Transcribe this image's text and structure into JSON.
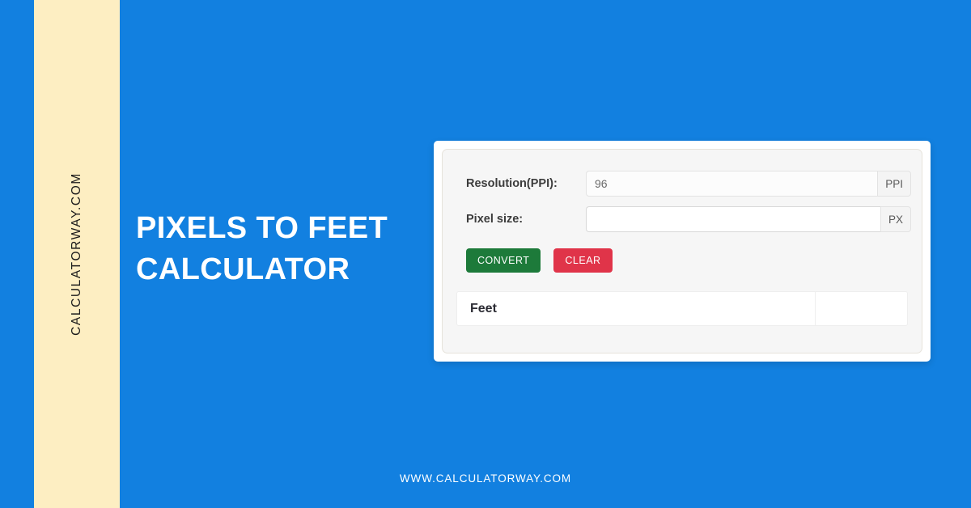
{
  "page": {
    "background_color": "#1280e0",
    "stripe_color": "#fdeec2",
    "headline": "PIXELS TO FEET CALCULATOR",
    "vertical_brand": "CALCULATORWAY.COM",
    "footer_url": "WWW.CALCULATORWAY.COM"
  },
  "calculator": {
    "fields": [
      {
        "label": "Resolution(PPI):",
        "value": "96",
        "placeholder": "",
        "unit": "PPI",
        "active": false
      },
      {
        "label": "Pixel size:",
        "value": "",
        "placeholder": "",
        "unit": "PX",
        "active": true
      }
    ],
    "buttons": {
      "convert_label": "CONVERT",
      "convert_color": "#1d7a3a",
      "clear_label": "CLEAR",
      "clear_color": "#e03449"
    },
    "result": {
      "label": "Feet",
      "value": ""
    }
  }
}
